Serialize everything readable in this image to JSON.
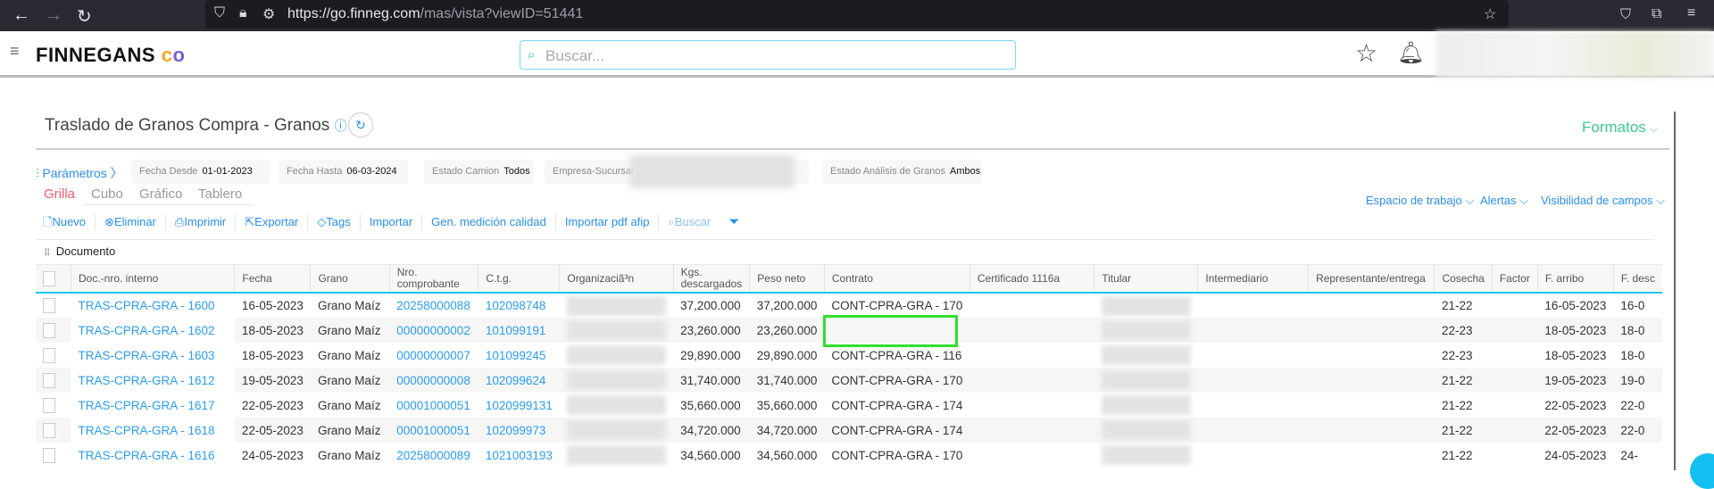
{
  "browser": {
    "url_host": "https://go.finneg.com",
    "url_path": "/mas/vista?viewID=51441"
  },
  "header": {
    "logo": "FINNEGANS",
    "search_placeholder": "Buscar..."
  },
  "page": {
    "title": "Traslado de Granos Compra - Granos",
    "formatos": "Formatos",
    "parametros": "Parámetros"
  },
  "params": [
    {
      "label": "Fecha Desde",
      "value": "01-01-2023"
    },
    {
      "label": "Fecha Hasta",
      "value": "06-03-2024"
    },
    {
      "label": "Estado Camion",
      "value": "Todos"
    },
    {
      "label": "Empresa-Sucursal",
      "value": ""
    },
    {
      "label": "Estado Análisis de Granos",
      "value": "Ambos"
    }
  ],
  "tabs": [
    "Grilla",
    "Cubo",
    "Gráfico",
    "Tablero"
  ],
  "right_links": [
    "Espacio de trabajo",
    "Alertas",
    "Visibilidad de campos"
  ],
  "toolbar": [
    "Nuevo",
    "Eliminar",
    "Imprimir",
    "Exportar",
    "Tags",
    "Importar",
    "Gen. medición calidad",
    "Importar pdf afip",
    "Buscar"
  ],
  "group_label": "Documento",
  "columns": [
    "Doc.-nro. interno",
    "Fecha",
    "Grano",
    "Nro. comprobante",
    "C.t.g.",
    "Organizaciã³n",
    "Kgs. descargados",
    "Peso neto",
    "Contrato",
    "Certificado 1116a",
    "Titular",
    "Intermediario",
    "Representante/entrega",
    "Cosecha",
    "Factor",
    "F. arribo",
    "F. desc"
  ],
  "rows": [
    [
      "TRAS-CPRA-GRA - 1600",
      "16-05-2023",
      "Grano Maíz",
      "20258000088",
      "102098748",
      "",
      "37,200.000",
      "37,200.000",
      "CONT-CPRA-GRA - 170",
      "",
      "",
      "",
      "",
      "21-22",
      "",
      "16-05-2023",
      "16-0"
    ],
    [
      "TRAS-CPRA-GRA - 1602",
      "18-05-2023",
      "Grano Maíz",
      "00000000002",
      "101099191",
      "",
      "23,260.000",
      "23,260.000",
      "",
      "",
      "",
      "",
      "",
      "22-23",
      "",
      "18-05-2023",
      "18-0"
    ],
    [
      "TRAS-CPRA-GRA - 1603",
      "18-05-2023",
      "Grano Maíz",
      "00000000007",
      "101099245",
      "",
      "29,890.000",
      "29,890.000",
      "CONT-CPRA-GRA - 116",
      "",
      "",
      "",
      "",
      "22-23",
      "",
      "18-05-2023",
      "18-0"
    ],
    [
      "TRAS-CPRA-GRA - 1612",
      "19-05-2023",
      "Grano Maíz",
      "00000000008",
      "102099624",
      "",
      "31,740.000",
      "31,740.000",
      "CONT-CPRA-GRA - 170",
      "",
      "",
      "",
      "",
      "21-22",
      "",
      "19-05-2023",
      "19-0"
    ],
    [
      "TRAS-CPRA-GRA - 1617",
      "22-05-2023",
      "Grano Maíz",
      "00001000051",
      "1020999131",
      "",
      "35,660.000",
      "35,660.000",
      "CONT-CPRA-GRA - 174",
      "",
      "",
      "",
      "",
      "21-22",
      "",
      "22-05-2023",
      "22-0"
    ],
    [
      "TRAS-CPRA-GRA - 1618",
      "22-05-2023",
      "Grano Maíz",
      "00001000051",
      "102099973",
      "",
      "34,720.000",
      "34,720.000",
      "CONT-CPRA-GRA - 174",
      "",
      "",
      "",
      "",
      "21-22",
      "",
      "22-05-2023",
      "22-0"
    ],
    [
      "TRAS-CPRA-GRA - 1616",
      "24-05-2023",
      "Grano Maíz",
      "20258000089",
      "1021003193",
      "",
      "34,560.000",
      "34,560.000",
      "CONT-CPRA-GRA - 170",
      "",
      "",
      "",
      "",
      "21-22",
      "",
      "24-05-2023",
      "24-"
    ]
  ],
  "colors": {
    "link": "#2a9df4",
    "active_tab": "#f25c6b",
    "formatos": "#3cc891",
    "highlight": "#2fe02f"
  }
}
